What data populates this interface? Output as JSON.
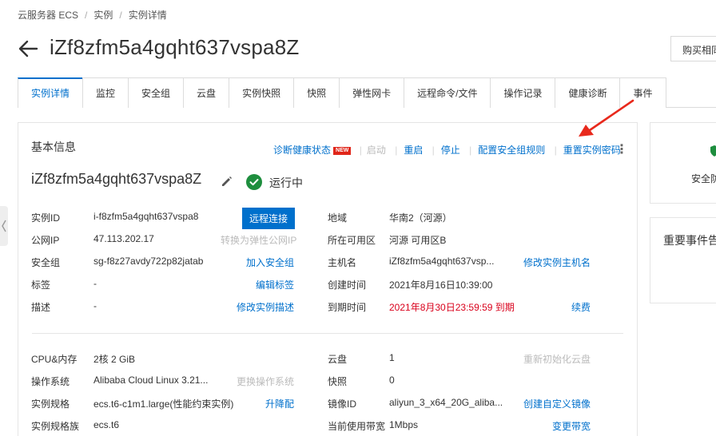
{
  "breadcrumb": {
    "items": [
      "云服务器 ECS",
      "实例",
      "实例详情"
    ],
    "sep": "/"
  },
  "header": {
    "title": "iZf8zfm5a4gqht637vspa8Z",
    "top_button": "购买相同"
  },
  "tabs": [
    "实例详情",
    "监控",
    "安全组",
    "云盘",
    "实例快照",
    "快照",
    "弹性网卡",
    "远程命令/文件",
    "操作记录",
    "健康诊断",
    "事件"
  ],
  "basic": {
    "title": "基本信息",
    "actions": {
      "diagnose": "诊断健康状态",
      "new_badge": "NEW",
      "start": "启动",
      "restart": "重启",
      "stop": "停止",
      "sg_rules": "配置安全组规则",
      "reset_pwd": "重置实例密码",
      "more": "⋮",
      "sep": "|"
    },
    "instance_name": "iZf8zfm5a4gqht637vspa8Z",
    "status": "运行中"
  },
  "fields": {
    "instance_id": {
      "label": "实例ID",
      "value": "i-f8zfm5a4gqht637vspa8",
      "button": "远程连接"
    },
    "public_ip": {
      "label": "公网IP",
      "value": "47.113.202.17",
      "action": "转换为弹性公网IP"
    },
    "security_group": {
      "label": "安全组",
      "value": "sg-f8z27avdy722p82jatab",
      "action": "加入安全组"
    },
    "tags": {
      "label": "标签",
      "value": "-",
      "action": "编辑标签"
    },
    "description": {
      "label": "描述",
      "value": "-",
      "action": "修改实例描述"
    },
    "region": {
      "label": "地域",
      "value": "华南2（河源）"
    },
    "zone": {
      "label": "所在可用区",
      "value": "河源 可用区B"
    },
    "hostname": {
      "label": "主机名",
      "value": "iZf8zfm5a4gqht637vsp...",
      "action": "修改实例主机名"
    },
    "created": {
      "label": "创建时间",
      "value": "2021年8月16日10:39:00"
    },
    "expires": {
      "label": "到期时间",
      "value": "2021年8月30日23:59:59 到期",
      "action": "续费"
    },
    "cpu_mem": {
      "label": "CPU&内存",
      "value": "2核 2 GiB"
    },
    "os": {
      "label": "操作系统",
      "value": "Alibaba Cloud Linux 3.21...",
      "action": "更换操作系统"
    },
    "spec": {
      "label": "实例规格",
      "value": "ecs.t6-c1m1.large(性能约束实例)",
      "action": "升降配"
    },
    "spec_family": {
      "label": "实例规格族",
      "value": "ecs.t6"
    },
    "disk": {
      "label": "云盘",
      "value": "1",
      "action": "重新初始化云盘"
    },
    "snapshot": {
      "label": "快照",
      "value": "0"
    },
    "image_id": {
      "label": "镜像ID",
      "value": "aliyun_3_x64_20G_aliba...",
      "action": "创建自定义镜像"
    },
    "bandwidth": {
      "label": "当前使用带宽",
      "value": "1Mbps",
      "action": "变更带宽"
    }
  },
  "side": {
    "card1_text": "安全防",
    "card2_title": "重要事件告"
  },
  "colors": {
    "primary": "#0070cc",
    "success": "#1e8e3e",
    "danger": "#d9001b",
    "annotation_arrow": "#e8291c"
  }
}
